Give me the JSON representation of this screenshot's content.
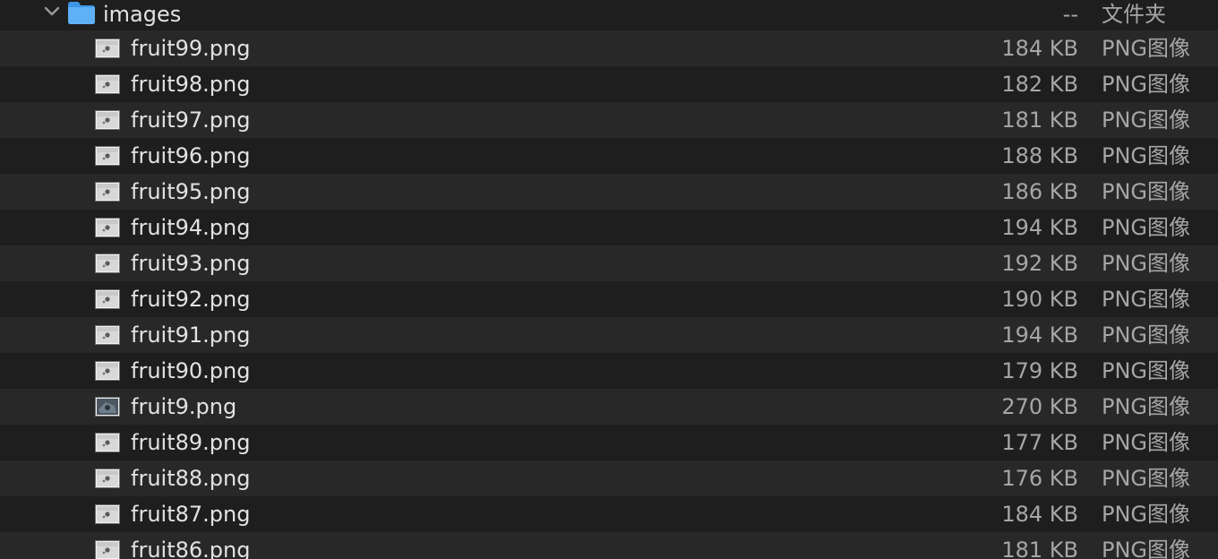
{
  "folder": {
    "name": "images",
    "size": "--",
    "kind": "文件夹",
    "expanded": true,
    "icon": "folder-icon",
    "chevron_icon": "chevron-down-icon",
    "folder_color": "#4aa4f4"
  },
  "files": [
    {
      "name": "fruit99.png",
      "size": "184 KB",
      "kind": "PNG图像"
    },
    {
      "name": "fruit98.png",
      "size": "182 KB",
      "kind": "PNG图像"
    },
    {
      "name": "fruit97.png",
      "size": "181 KB",
      "kind": "PNG图像"
    },
    {
      "name": "fruit96.png",
      "size": "188 KB",
      "kind": "PNG图像"
    },
    {
      "name": "fruit95.png",
      "size": "186 KB",
      "kind": "PNG图像"
    },
    {
      "name": "fruit94.png",
      "size": "194 KB",
      "kind": "PNG图像"
    },
    {
      "name": "fruit93.png",
      "size": "192 KB",
      "kind": "PNG图像"
    },
    {
      "name": "fruit92.png",
      "size": "190 KB",
      "kind": "PNG图像"
    },
    {
      "name": "fruit91.png",
      "size": "194 KB",
      "kind": "PNG图像"
    },
    {
      "name": "fruit90.png",
      "size": "179 KB",
      "kind": "PNG图像"
    },
    {
      "name": "fruit9.png",
      "size": "270 KB",
      "kind": "PNG图像"
    },
    {
      "name": "fruit89.png",
      "size": "177 KB",
      "kind": "PNG图像"
    },
    {
      "name": "fruit88.png",
      "size": "176 KB",
      "kind": "PNG图像"
    },
    {
      "name": "fruit87.png",
      "size": "184 KB",
      "kind": "PNG图像"
    },
    {
      "name": "fruit86.png",
      "size": "181 KB",
      "kind": "PNG图像"
    }
  ],
  "file_icon": "image-thumbnail-icon",
  "colors": {
    "background": "#1e1e1e",
    "alt_row": "#282828",
    "text": "#e2e2e2",
    "secondary_text": "#a6a6a6"
  }
}
